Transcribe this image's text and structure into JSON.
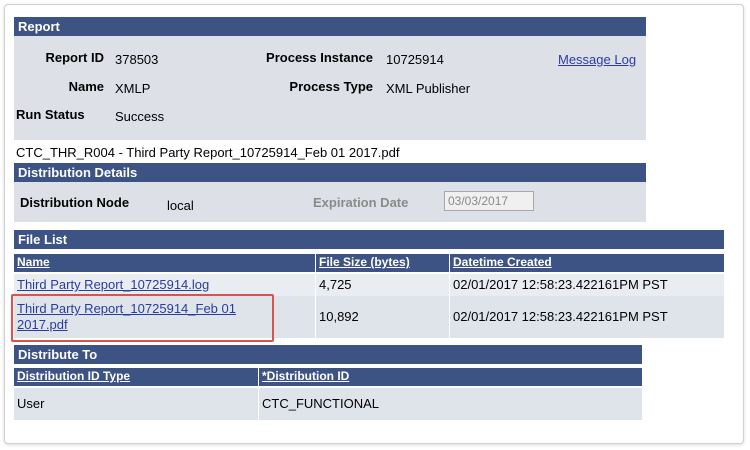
{
  "report": {
    "header": "Report",
    "report_id_label": "Report ID",
    "report_id": "378503",
    "process_instance_label": "Process Instance",
    "process_instance": "10725914",
    "message_log": "Message Log",
    "name_label": "Name",
    "name": "XMLP",
    "process_type_label": "Process Type",
    "process_type": "XML Publisher",
    "run_status_label": "Run Status",
    "run_status": "Success"
  },
  "file_title": "CTC_THR_R004 - Third Party Report_10725914_Feb 01 2017.pdf",
  "distribution": {
    "header": "Distribution Details",
    "node_label": "Distribution Node",
    "node": "local",
    "expiration_label": "Expiration Date",
    "expiration": "03/03/2017"
  },
  "file_list": {
    "header": "File List",
    "columns": [
      "Name",
      "File Size (bytes)",
      "Datetime Created"
    ],
    "rows": [
      {
        "name": "Third Party Report_10725914.log",
        "size": "4,725",
        "created": "02/01/2017 12:58:23.422161PM PST"
      },
      {
        "name_line1": "Third Party Report_10725914_Feb 01",
        "name_line2": "2017.pdf",
        "size": "10,892",
        "created": "02/01/2017 12:58:23.422161PM PST"
      }
    ]
  },
  "distribute_to": {
    "header": "Distribute To",
    "columns": [
      "Distribution ID Type",
      "*Distribution ID"
    ],
    "rows": [
      {
        "type": "User",
        "id": "CTC_FUNCTIONAL"
      }
    ]
  },
  "colors": {
    "header_bg": "#3c5383",
    "panel_bg": "#dde1e7",
    "link": "#2a3ca0",
    "highlight": "#d9534f"
  }
}
